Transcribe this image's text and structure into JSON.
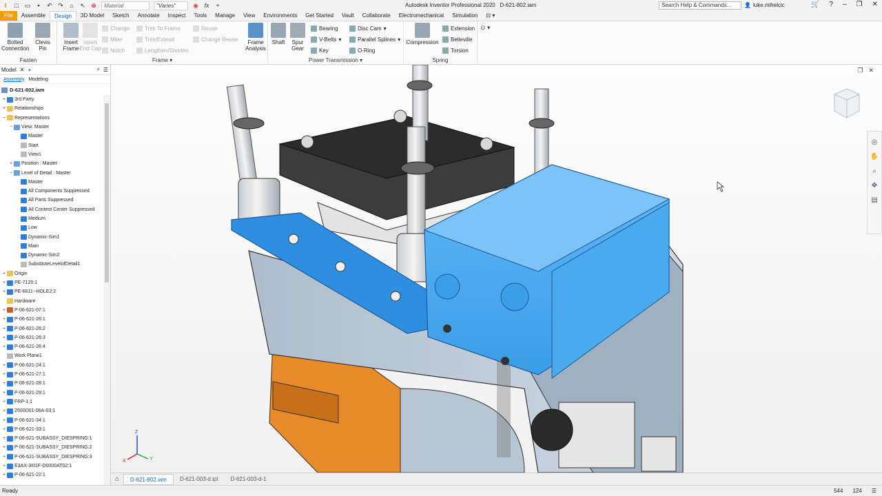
{
  "app": {
    "title": "Autodesk Inventor Professional 2020",
    "document": "D-621-802.iam",
    "material": "Material",
    "appearance": "\"Varies\"",
    "search_placeholder": "Search Help & Commands...",
    "user": "luke.mihelcic"
  },
  "tabs": [
    "File",
    "Assemble",
    "Design",
    "3D Model",
    "Sketch",
    "Annotate",
    "Inspect",
    "Tools",
    "Manage",
    "View",
    "Environments",
    "Get Started",
    "Vault",
    "Collaborate",
    "Electromechanical",
    "Simulation"
  ],
  "active_tab": "Design",
  "ribbon": {
    "fasten": {
      "title": "Fasten",
      "bolted": "Bolted\nConnection",
      "clevis": "Clevis\nPin"
    },
    "frame": {
      "title": "Frame",
      "insert_frame": "Insert\nFrame",
      "insert_end_cap": "Insert\nEnd Cap",
      "change": "Change",
      "miter": "Miter",
      "notch": "Notch",
      "trim_to_frame": "Trim To Frame",
      "trim_extend": "Trim/Extend",
      "lengthen": "Lengthen/Shorten",
      "reuse": "Reuse",
      "change_reuse": "Change Reuse",
      "frame_analysis": "Frame\nAnalysis"
    },
    "power": {
      "title": "Power Transmission",
      "shaft": "Shaft",
      "spur_gear": "Spur\nGear",
      "bearing": "Bearing",
      "vbelts": "V-Belts",
      "key": "Key",
      "disc_cam": "Disc Cam",
      "parallel_splines": "Parallel Splines",
      "oring": "O-Ring"
    },
    "spring": {
      "title": "Spring",
      "compression": "Compression",
      "extension": "Extension",
      "belleville": "Belleville",
      "torsion": "Torsion"
    }
  },
  "browser": {
    "title": "Model",
    "sub_assembly": "Assembly",
    "sub_modeling": "Modeling",
    "root": "D-621-802.iam",
    "nodes": [
      {
        "label": "3rd Party",
        "indent": 0,
        "ex": "+",
        "color": "#3a7fd0"
      },
      {
        "label": "Relationships",
        "indent": 0,
        "ex": "+",
        "color": "#e8c35a"
      },
      {
        "label": "Representations",
        "indent": 0,
        "ex": "−",
        "color": "#e8c35a"
      },
      {
        "label": "View: Master",
        "indent": 1,
        "ex": "−",
        "color": "#6aa0d8"
      },
      {
        "label": "Master",
        "indent": 2,
        "ex": "",
        "color": "#2f7fd8"
      },
      {
        "label": "Start",
        "indent": 2,
        "ex": "",
        "color": "#bbb"
      },
      {
        "label": "View1",
        "indent": 2,
        "ex": "",
        "color": "#bbb"
      },
      {
        "label": "Position : Master",
        "indent": 1,
        "ex": "+",
        "color": "#6aa0d8"
      },
      {
        "label": "Level of Detail : Master",
        "indent": 1,
        "ex": "−",
        "color": "#6aa0d8"
      },
      {
        "label": "Master",
        "indent": 2,
        "ex": "",
        "color": "#2f7fd8"
      },
      {
        "label": "All Components Suppressed",
        "indent": 2,
        "ex": "",
        "color": "#2f7fd8"
      },
      {
        "label": "All Parts Suppressed",
        "indent": 2,
        "ex": "",
        "color": "#2f7fd8"
      },
      {
        "label": "All Content Center Suppressed",
        "indent": 2,
        "ex": "",
        "color": "#2f7fd8"
      },
      {
        "label": "Medium",
        "indent": 2,
        "ex": "",
        "color": "#2f7fd8"
      },
      {
        "label": "Low",
        "indent": 2,
        "ex": "",
        "color": "#2f7fd8"
      },
      {
        "label": "Dynamic-Sim1",
        "indent": 2,
        "ex": "",
        "color": "#2f7fd8"
      },
      {
        "label": "Main",
        "indent": 2,
        "ex": "",
        "color": "#2f7fd8"
      },
      {
        "label": "Dynamic-Sim2",
        "indent": 2,
        "ex": "",
        "color": "#2f7fd8"
      },
      {
        "label": "SubstituteLevelofDetail1",
        "indent": 2,
        "ex": "",
        "color": "#bbb"
      },
      {
        "label": "Origin",
        "indent": 0,
        "ex": "+",
        "color": "#e8c35a"
      },
      {
        "label": "PE-7120:1",
        "indent": 0,
        "ex": "+",
        "color": "#2f7fd8"
      },
      {
        "label": "PE-6611--HOLE2:2",
        "indent": 0,
        "ex": "+",
        "color": "#2f7fd8"
      },
      {
        "label": "Hardware",
        "indent": 0,
        "ex": "",
        "color": "#e8c35a"
      },
      {
        "label": "P-06-621-07:1",
        "indent": 0,
        "ex": "+",
        "color": "#c06030"
      },
      {
        "label": "P-06-621-26:1",
        "indent": 0,
        "ex": "+",
        "color": "#2f7fd8"
      },
      {
        "label": "P-06-621-26:2",
        "indent": 0,
        "ex": "+",
        "color": "#2f7fd8"
      },
      {
        "label": "P-06-621-26:3",
        "indent": 0,
        "ex": "+",
        "color": "#2f7fd8"
      },
      {
        "label": "P-06-621-26:4",
        "indent": 0,
        "ex": "+",
        "color": "#2f7fd8"
      },
      {
        "label": "Work Plane1",
        "indent": 0,
        "ex": "",
        "color": "#bbb"
      },
      {
        "label": "P-06-621-24:1",
        "indent": 0,
        "ex": "+",
        "color": "#2f7fd8"
      },
      {
        "label": "P-06-621-27:1",
        "indent": 0,
        "ex": "+",
        "color": "#2f7fd8"
      },
      {
        "label": "P-06-621-28:1",
        "indent": 0,
        "ex": "+",
        "color": "#2f7fd8"
      },
      {
        "label": "P-06-621-29:1",
        "indent": 0,
        "ex": "+",
        "color": "#2f7fd8"
      },
      {
        "label": "FRP-1:1",
        "indent": 0,
        "ex": "+",
        "color": "#2f7fd8"
      },
      {
        "label": "2500D01-06A-03:1",
        "indent": 0,
        "ex": "+",
        "color": "#2f7fd8"
      },
      {
        "label": "P-06-621-34:1",
        "indent": 0,
        "ex": "+",
        "color": "#2f7fd8"
      },
      {
        "label": "P-06-621-33:1",
        "indent": 0,
        "ex": "+",
        "color": "#2f7fd8"
      },
      {
        "label": "P-06-621-SUBASSY_DIESPRING:1",
        "indent": 0,
        "ex": "+",
        "color": "#2f7fd8"
      },
      {
        "label": "P-06-621-SUBASSY_DIESPRING:2",
        "indent": 0,
        "ex": "+",
        "color": "#2f7fd8"
      },
      {
        "label": "P-06-621-SUBASSY_DIESPRING:3",
        "indent": 0,
        "ex": "+",
        "color": "#2f7fd8"
      },
      {
        "label": "E3AX-3I01F-D0000AT02:1",
        "indent": 0,
        "ex": "+",
        "color": "#2f7fd8"
      },
      {
        "label": "P-06-621-22:1",
        "indent": 0,
        "ex": "+",
        "color": "#2f7fd8"
      }
    ]
  },
  "doc_tabs": [
    "D-621-802.iam",
    "D-621-003-d.ipt",
    "D-621-003-d-1"
  ],
  "status": {
    "text": "Ready",
    "n1": "544",
    "n2": "124"
  },
  "colors": {
    "selected": "#3aa0ee",
    "accent": "#0a66b8",
    "file_tab": "#f0a000"
  }
}
